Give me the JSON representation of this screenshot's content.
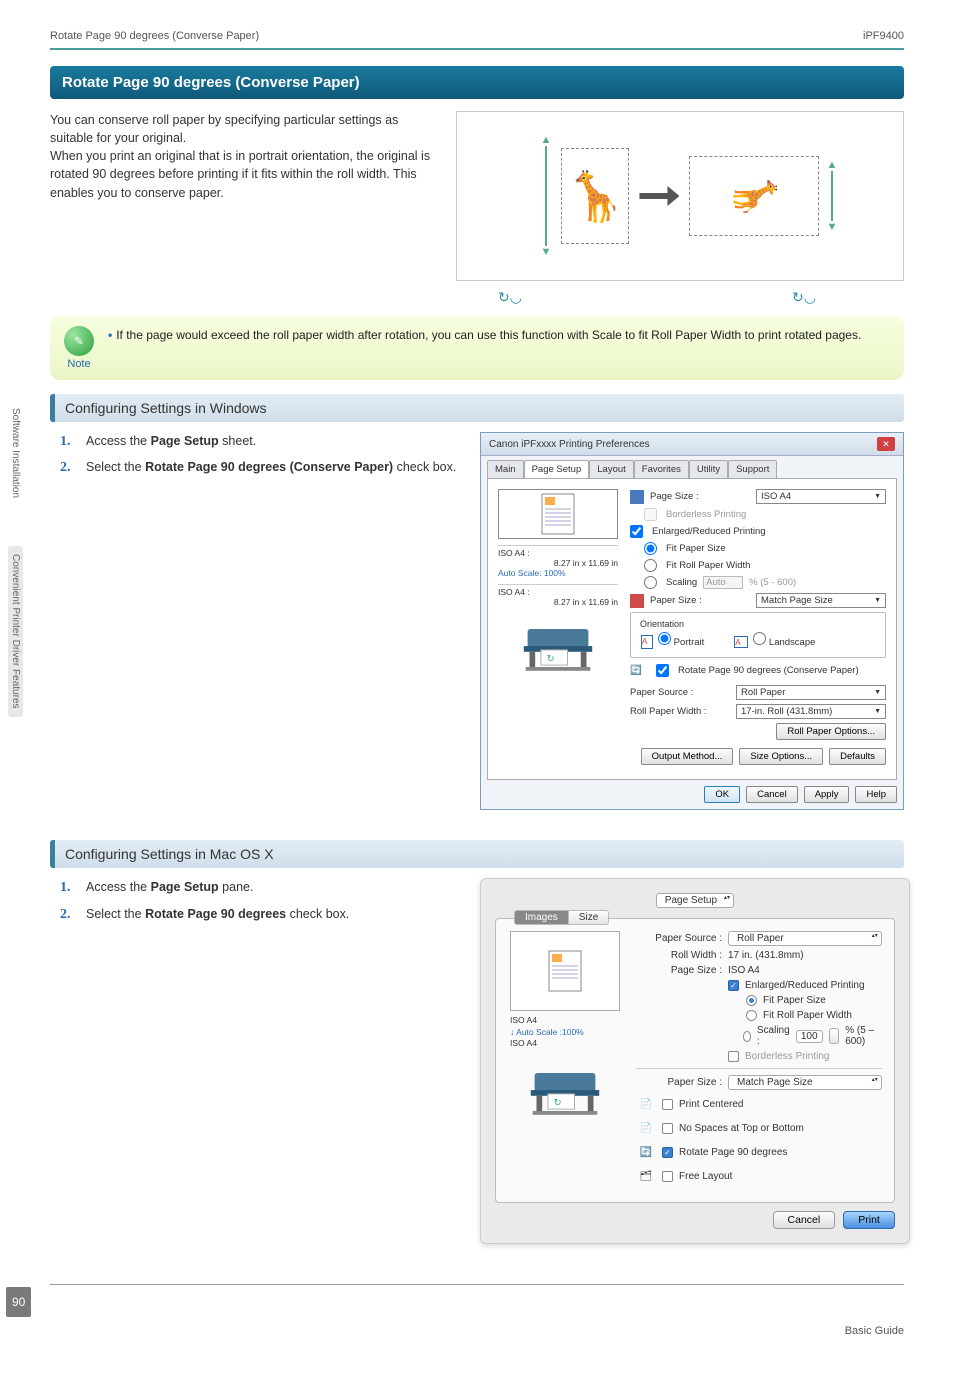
{
  "header": {
    "left": "Rotate Page 90 degrees (Converse Paper)",
    "right": "iPF9400"
  },
  "title": "Rotate Page 90 degrees (Converse Paper)",
  "intro": "You can conserve roll paper by specifying particular settings as suitable for your original.\nWhen you print an original that is in portrait orientation, the original is rotated 90 degrees before printing if it fits within the roll width. This enables you to conserve paper.",
  "note": {
    "label": "Note",
    "text": "If the page would exceed the roll paper width after rotation, you can use this function with Scale to fit Roll Paper Width to print rotated pages."
  },
  "windows": {
    "title": "Configuring Settings in Windows",
    "steps": [
      {
        "pre": "Access the ",
        "bold": "Page Setup",
        "post": " sheet."
      },
      {
        "pre": "Select the ",
        "bold": "Rotate Page 90 degrees (Conserve Paper)",
        "post": " check box."
      }
    ],
    "dialog": {
      "title": "Canon iPFxxxx Printing Preferences",
      "tabs": [
        "Main",
        "Page Setup",
        "Layout",
        "Favorites",
        "Utility",
        "Support"
      ],
      "activeTab": "Page Setup",
      "preview": {
        "label1": "ISO A4 :",
        "dim1": "8.27 in x 11.69 in",
        "scale": "Auto Scale: 100%",
        "label2": "ISO A4 :",
        "dim2": "8.27 in x 11.69 in"
      },
      "pageSizeLabel": "Page Size :",
      "pageSizeValue": "ISO A4",
      "borderless": "Borderless Printing",
      "enlarged": "Enlarged/Reduced Printing",
      "fitPaper": "Fit Paper Size",
      "fitRoll": "Fit Roll Paper Width",
      "scaling": "Scaling",
      "scalingSpinner": "Auto",
      "scalingRange": "% (5 - 600)",
      "paperSizeLabel": "Paper Size :",
      "paperSizeValue": "Match Page Size",
      "orientation": "Orientation",
      "portrait": "Portrait",
      "landscape": "Landscape",
      "rotate90": "Rotate Page 90 degrees (Conserve Paper)",
      "paperSourceLabel": "Paper Source :",
      "paperSourceValue": "Roll Paper",
      "rollWidthLabel": "Roll Paper Width :",
      "rollWidthValue": "17-in. Roll (431.8mm)",
      "rollOptions": "Roll Paper Options...",
      "outputMethod": "Output Method...",
      "sizeOptions": "Size Options...",
      "defaults": "Defaults",
      "ok": "OK",
      "cancel": "Cancel",
      "apply": "Apply",
      "help": "Help"
    }
  },
  "mac": {
    "title": "Configuring Settings in Mac OS X",
    "steps": [
      {
        "pre": "Access the ",
        "bold": "Page Setup",
        "post": " pane."
      },
      {
        "pre": "Select the ",
        "bold": "Rotate Page 90 degrees",
        "post": " check box."
      }
    ],
    "dialog": {
      "paneSelector": "Page Setup",
      "tabs": [
        "Images",
        "Size"
      ],
      "activeTab": "Images",
      "preview": {
        "label1": "ISO A4",
        "scale": "Auto Scale :100%",
        "label2": "ISO A4"
      },
      "paperSourceLabel": "Paper Source :",
      "paperSourceValue": "Roll Paper",
      "rollWidthLabel": "Roll Width :",
      "rollWidthValue": "17 in. (431.8mm)",
      "pageSizeLabel": "Page Size :",
      "pageSizeValue": "ISO A4",
      "enlarged": "Enlarged/Reduced Printing",
      "fitPaper": "Fit Paper Size",
      "fitRoll": "Fit Roll Paper Width",
      "scaling": "Scaling :",
      "scalingValue": "100",
      "scalingRange": "% (5 – 600)",
      "borderless": "Borderless Printing",
      "paperSizeLabel": "Paper Size :",
      "paperSizeValue": "Match Page Size",
      "printCentered": "Print Centered",
      "noSpaces": "No Spaces at Top or Bottom",
      "rotate90": "Rotate Page 90 degrees",
      "freeLayout": "Free Layout",
      "cancel": "Cancel",
      "print": "Print"
    }
  },
  "sidebar": {
    "item1": "Software Installation",
    "item2": "Convenient Printer Driver Features"
  },
  "pageNumber": "90",
  "footer": "Basic Guide"
}
